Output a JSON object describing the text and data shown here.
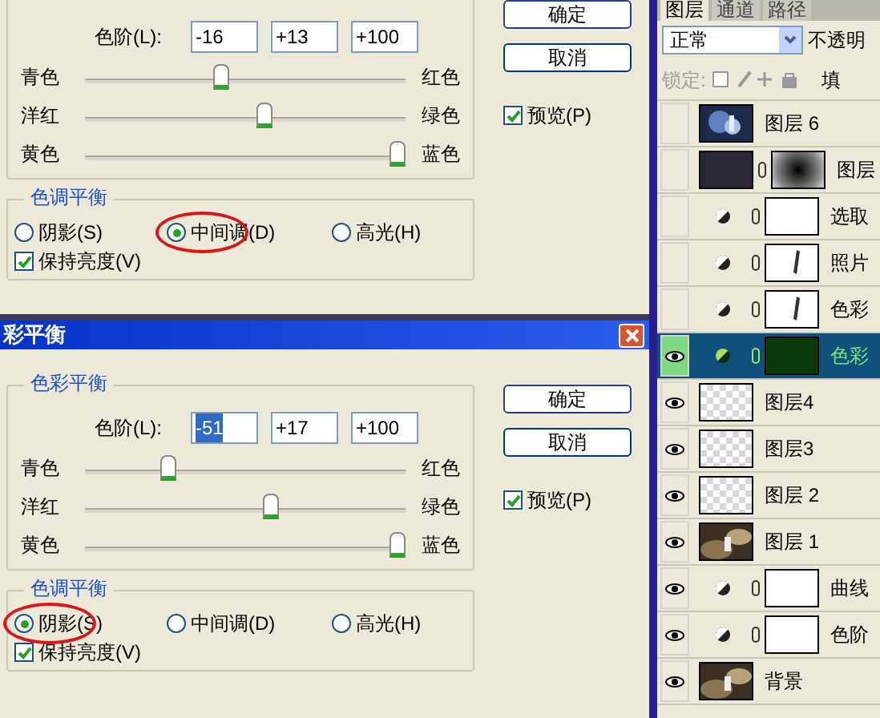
{
  "dialogs": [
    {
      "color_group": {
        "levels_label": "色阶(L):",
        "values": [
          {
            "text": "-16",
            "selected": false
          },
          {
            "text": "+13",
            "selected": false
          },
          {
            "text": "+100",
            "selected": false
          }
        ],
        "sliders": [
          {
            "left": "青色",
            "right": "红色",
            "level": 0.42
          },
          {
            "left": "洋红",
            "right": "绿色",
            "level": 0.565
          },
          {
            "left": "黄色",
            "right": "蓝色",
            "level": 1.0
          }
        ]
      },
      "tone_group": {
        "legend": "色调平衡",
        "radios": [
          {
            "label": "阴影(S)",
            "selected": false,
            "circled": false
          },
          {
            "label": "中间调(D)",
            "selected": true,
            "circled": true
          },
          {
            "label": "高光(H)",
            "selected": false,
            "circled": false
          }
        ],
        "preserve": {
          "label": "保持亮度(V)",
          "checked": true
        }
      },
      "buttons": [
        "确定",
        "取消"
      ],
      "preview": {
        "label": "预览(P)",
        "checked": true
      }
    },
    {
      "title": "彩平衡",
      "color_group": {
        "legend": "色彩平衡",
        "levels_label": "色阶(L):",
        "values": [
          {
            "text": "-51",
            "selected": true
          },
          {
            "text": "+17",
            "selected": false
          },
          {
            "text": "+100",
            "selected": false
          }
        ],
        "sliders": [
          {
            "left": "青色",
            "right": "红色",
            "level": 0.245
          },
          {
            "left": "洋红",
            "right": "绿色",
            "level": 0.585
          },
          {
            "left": "黄色",
            "right": "蓝色",
            "level": 1.0
          }
        ]
      },
      "tone_group": {
        "legend": "色调平衡",
        "radios": [
          {
            "label": "阴影(S)",
            "selected": true,
            "circled": true
          },
          {
            "label": "中间调(D)",
            "selected": false,
            "circled": false
          },
          {
            "label": "高光(H)",
            "selected": false,
            "circled": false
          }
        ],
        "preserve": {
          "label": "保持亮度(V)",
          "checked": true
        }
      },
      "buttons": [
        "确定",
        "取消"
      ],
      "preview": {
        "label": "预览(P)",
        "checked": true
      }
    }
  ],
  "layers_panel": {
    "tabs": [
      {
        "label": "图层",
        "selected": true
      },
      {
        "label": "通道",
        "selected": false
      },
      {
        "label": "路径",
        "selected": false
      }
    ],
    "blend_mode": "正常",
    "opacity_label": "不透明",
    "lock_label": "锁定:",
    "fill_label": "填",
    "layers": [
      {
        "name": "图层 6",
        "kind": "pixel",
        "thumb": {
          "kind": "photo-blue"
        },
        "visible": false,
        "selected": false
      },
      {
        "name": "图层",
        "kind": "masked",
        "thumb": {
          "kind": "dark"
        },
        "mask": {
          "kind": "radial"
        },
        "visible": false,
        "selected": false
      },
      {
        "name": "选取",
        "kind": "adjustment",
        "mask": {
          "kind": "white"
        },
        "visible": false,
        "selected": false
      },
      {
        "name": "照片",
        "kind": "adjustment",
        "mask": {
          "kind": "stroke"
        },
        "visible": false,
        "selected": false
      },
      {
        "name": "色彩",
        "kind": "adjustment",
        "mask": {
          "kind": "stroke"
        },
        "visible": false,
        "selected": false
      },
      {
        "name": "色彩",
        "kind": "adjustment",
        "mask": {
          "kind": "green"
        },
        "visible": true,
        "selected": true
      },
      {
        "name": "图层4",
        "kind": "pixel",
        "thumb": {
          "kind": "checker"
        },
        "visible": true,
        "selected": false
      },
      {
        "name": "图层3",
        "kind": "pixel",
        "thumb": {
          "kind": "checker"
        },
        "visible": true,
        "selected": false
      },
      {
        "name": "图层 2",
        "kind": "pixel",
        "thumb": {
          "kind": "checker"
        },
        "visible": true,
        "selected": false
      },
      {
        "name": "图层 1",
        "kind": "pixel",
        "thumb": {
          "kind": "photo-warm"
        },
        "visible": true,
        "selected": false
      },
      {
        "name": "曲线",
        "kind": "adjustment",
        "mask": {
          "kind": "white"
        },
        "visible": true,
        "selected": false
      },
      {
        "name": "色阶",
        "kind": "adjustment",
        "mask": {
          "kind": "white"
        },
        "visible": true,
        "selected": false
      },
      {
        "name": "背景",
        "kind": "pixel",
        "thumb": {
          "kind": "photo-warm"
        },
        "visible": true,
        "selected": false
      }
    ]
  }
}
